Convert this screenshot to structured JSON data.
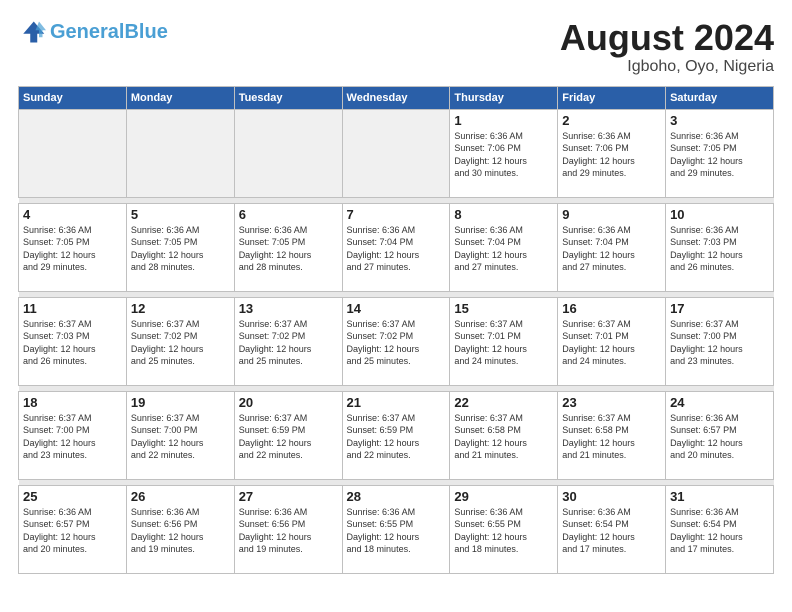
{
  "header": {
    "logo_line1": "General",
    "logo_line2": "Blue",
    "month_year": "August 2024",
    "location": "Igboho, Oyo, Nigeria"
  },
  "weekdays": [
    "Sunday",
    "Monday",
    "Tuesday",
    "Wednesday",
    "Thursday",
    "Friday",
    "Saturday"
  ],
  "weeks": [
    [
      {
        "day": "",
        "info": ""
      },
      {
        "day": "",
        "info": ""
      },
      {
        "day": "",
        "info": ""
      },
      {
        "day": "",
        "info": ""
      },
      {
        "day": "1",
        "info": "Sunrise: 6:36 AM\nSunset: 7:06 PM\nDaylight: 12 hours\nand 30 minutes."
      },
      {
        "day": "2",
        "info": "Sunrise: 6:36 AM\nSunset: 7:06 PM\nDaylight: 12 hours\nand 29 minutes."
      },
      {
        "day": "3",
        "info": "Sunrise: 6:36 AM\nSunset: 7:05 PM\nDaylight: 12 hours\nand 29 minutes."
      }
    ],
    [
      {
        "day": "4",
        "info": "Sunrise: 6:36 AM\nSunset: 7:05 PM\nDaylight: 12 hours\nand 29 minutes."
      },
      {
        "day": "5",
        "info": "Sunrise: 6:36 AM\nSunset: 7:05 PM\nDaylight: 12 hours\nand 28 minutes."
      },
      {
        "day": "6",
        "info": "Sunrise: 6:36 AM\nSunset: 7:05 PM\nDaylight: 12 hours\nand 28 minutes."
      },
      {
        "day": "7",
        "info": "Sunrise: 6:36 AM\nSunset: 7:04 PM\nDaylight: 12 hours\nand 27 minutes."
      },
      {
        "day": "8",
        "info": "Sunrise: 6:36 AM\nSunset: 7:04 PM\nDaylight: 12 hours\nand 27 minutes."
      },
      {
        "day": "9",
        "info": "Sunrise: 6:36 AM\nSunset: 7:04 PM\nDaylight: 12 hours\nand 27 minutes."
      },
      {
        "day": "10",
        "info": "Sunrise: 6:36 AM\nSunset: 7:03 PM\nDaylight: 12 hours\nand 26 minutes."
      }
    ],
    [
      {
        "day": "11",
        "info": "Sunrise: 6:37 AM\nSunset: 7:03 PM\nDaylight: 12 hours\nand 26 minutes."
      },
      {
        "day": "12",
        "info": "Sunrise: 6:37 AM\nSunset: 7:02 PM\nDaylight: 12 hours\nand 25 minutes."
      },
      {
        "day": "13",
        "info": "Sunrise: 6:37 AM\nSunset: 7:02 PM\nDaylight: 12 hours\nand 25 minutes."
      },
      {
        "day": "14",
        "info": "Sunrise: 6:37 AM\nSunset: 7:02 PM\nDaylight: 12 hours\nand 25 minutes."
      },
      {
        "day": "15",
        "info": "Sunrise: 6:37 AM\nSunset: 7:01 PM\nDaylight: 12 hours\nand 24 minutes."
      },
      {
        "day": "16",
        "info": "Sunrise: 6:37 AM\nSunset: 7:01 PM\nDaylight: 12 hours\nand 24 minutes."
      },
      {
        "day": "17",
        "info": "Sunrise: 6:37 AM\nSunset: 7:00 PM\nDaylight: 12 hours\nand 23 minutes."
      }
    ],
    [
      {
        "day": "18",
        "info": "Sunrise: 6:37 AM\nSunset: 7:00 PM\nDaylight: 12 hours\nand 23 minutes."
      },
      {
        "day": "19",
        "info": "Sunrise: 6:37 AM\nSunset: 7:00 PM\nDaylight: 12 hours\nand 22 minutes."
      },
      {
        "day": "20",
        "info": "Sunrise: 6:37 AM\nSunset: 6:59 PM\nDaylight: 12 hours\nand 22 minutes."
      },
      {
        "day": "21",
        "info": "Sunrise: 6:37 AM\nSunset: 6:59 PM\nDaylight: 12 hours\nand 22 minutes."
      },
      {
        "day": "22",
        "info": "Sunrise: 6:37 AM\nSunset: 6:58 PM\nDaylight: 12 hours\nand 21 minutes."
      },
      {
        "day": "23",
        "info": "Sunrise: 6:37 AM\nSunset: 6:58 PM\nDaylight: 12 hours\nand 21 minutes."
      },
      {
        "day": "24",
        "info": "Sunrise: 6:36 AM\nSunset: 6:57 PM\nDaylight: 12 hours\nand 20 minutes."
      }
    ],
    [
      {
        "day": "25",
        "info": "Sunrise: 6:36 AM\nSunset: 6:57 PM\nDaylight: 12 hours\nand 20 minutes."
      },
      {
        "day": "26",
        "info": "Sunrise: 6:36 AM\nSunset: 6:56 PM\nDaylight: 12 hours\nand 19 minutes."
      },
      {
        "day": "27",
        "info": "Sunrise: 6:36 AM\nSunset: 6:56 PM\nDaylight: 12 hours\nand 19 minutes."
      },
      {
        "day": "28",
        "info": "Sunrise: 6:36 AM\nSunset: 6:55 PM\nDaylight: 12 hours\nand 18 minutes."
      },
      {
        "day": "29",
        "info": "Sunrise: 6:36 AM\nSunset: 6:55 PM\nDaylight: 12 hours\nand 18 minutes."
      },
      {
        "day": "30",
        "info": "Sunrise: 6:36 AM\nSunset: 6:54 PM\nDaylight: 12 hours\nand 17 minutes."
      },
      {
        "day": "31",
        "info": "Sunrise: 6:36 AM\nSunset: 6:54 PM\nDaylight: 12 hours\nand 17 minutes."
      }
    ]
  ]
}
